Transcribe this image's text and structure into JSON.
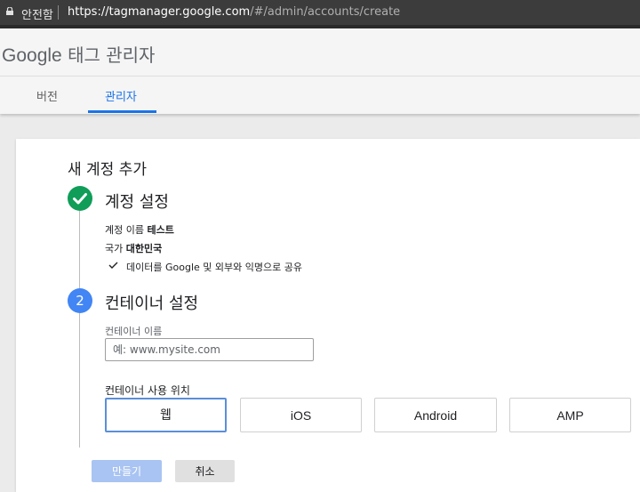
{
  "browser": {
    "security_label": "안전함",
    "url_main": "https://tagmanager.google.com",
    "url_path": "/#/admin/accounts/create"
  },
  "header": {
    "brand": "Google",
    "product": "태그 관리자"
  },
  "tabs": [
    {
      "label": "버전",
      "active": false
    },
    {
      "label": "관리자",
      "active": true
    }
  ],
  "form": {
    "title": "새 계정 추가",
    "step1": {
      "heading": "계정 설정",
      "account_name_label": "계정 이름",
      "account_name_value": "테스트",
      "country_label": "국가",
      "country_value": "대한민국",
      "share_text": "데이터를 Google 및 외부와 익명으로 공유"
    },
    "step2": {
      "number": "2",
      "heading": "컨테이너 설정",
      "container_name_label": "컨테이너 이름",
      "container_name_placeholder": "예: www.mysite.com",
      "container_name_value": "",
      "usage_label": "컨테이너 사용 위치",
      "platforms": [
        "웹",
        "iOS",
        "Android",
        "AMP"
      ],
      "selected_platform": "웹"
    },
    "create_label": "만들기",
    "cancel_label": "취소"
  },
  "colors": {
    "accent": "#1a73e8",
    "success": "#0f9d58",
    "step_active": "#4285f4"
  }
}
